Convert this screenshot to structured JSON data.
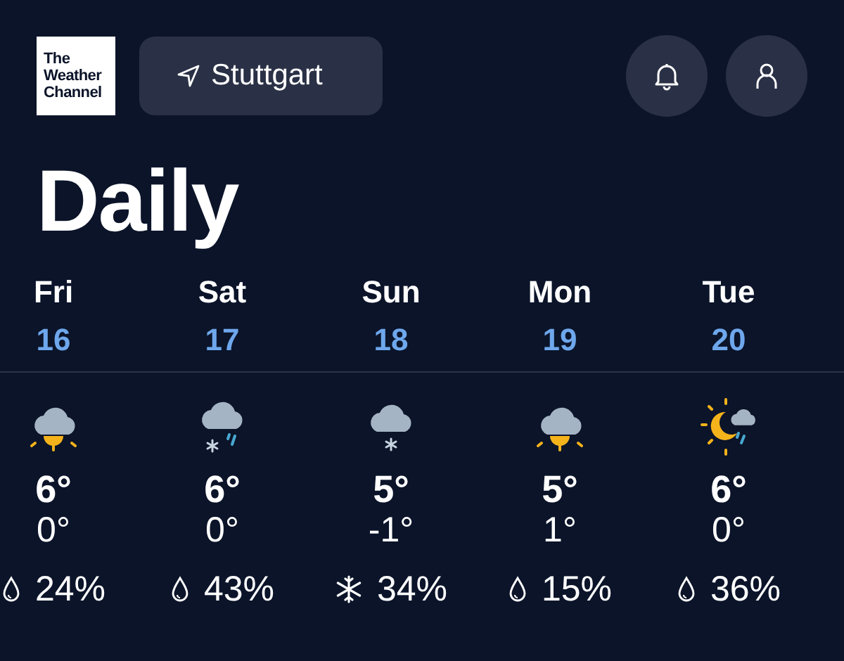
{
  "header": {
    "logo": [
      "The",
      "Weather",
      "Channel"
    ],
    "location": "Stuttgart"
  },
  "title": "Daily",
  "days": [
    {
      "day": "Fri",
      "date": "16",
      "kind": "partly",
      "high": "6°",
      "low": "0°",
      "precip": {
        "kind": "rain",
        "text": "24%"
      }
    },
    {
      "day": "Sat",
      "date": "17",
      "kind": "mixed",
      "high": "6°",
      "low": "0°",
      "precip": {
        "kind": "rain",
        "text": "43%"
      }
    },
    {
      "day": "Sun",
      "date": "18",
      "kind": "snow",
      "high": "5°",
      "low": "-1°",
      "precip": {
        "kind": "snow",
        "text": "34%"
      }
    },
    {
      "day": "Mon",
      "date": "19",
      "kind": "partly",
      "high": "5°",
      "low": "1°",
      "precip": {
        "kind": "rain",
        "text": "15%"
      }
    },
    {
      "day": "Tue",
      "date": "20",
      "kind": "night",
      "high": "6°",
      "low": "0°",
      "precip": {
        "kind": "rain",
        "text": "36%"
      }
    }
  ]
}
